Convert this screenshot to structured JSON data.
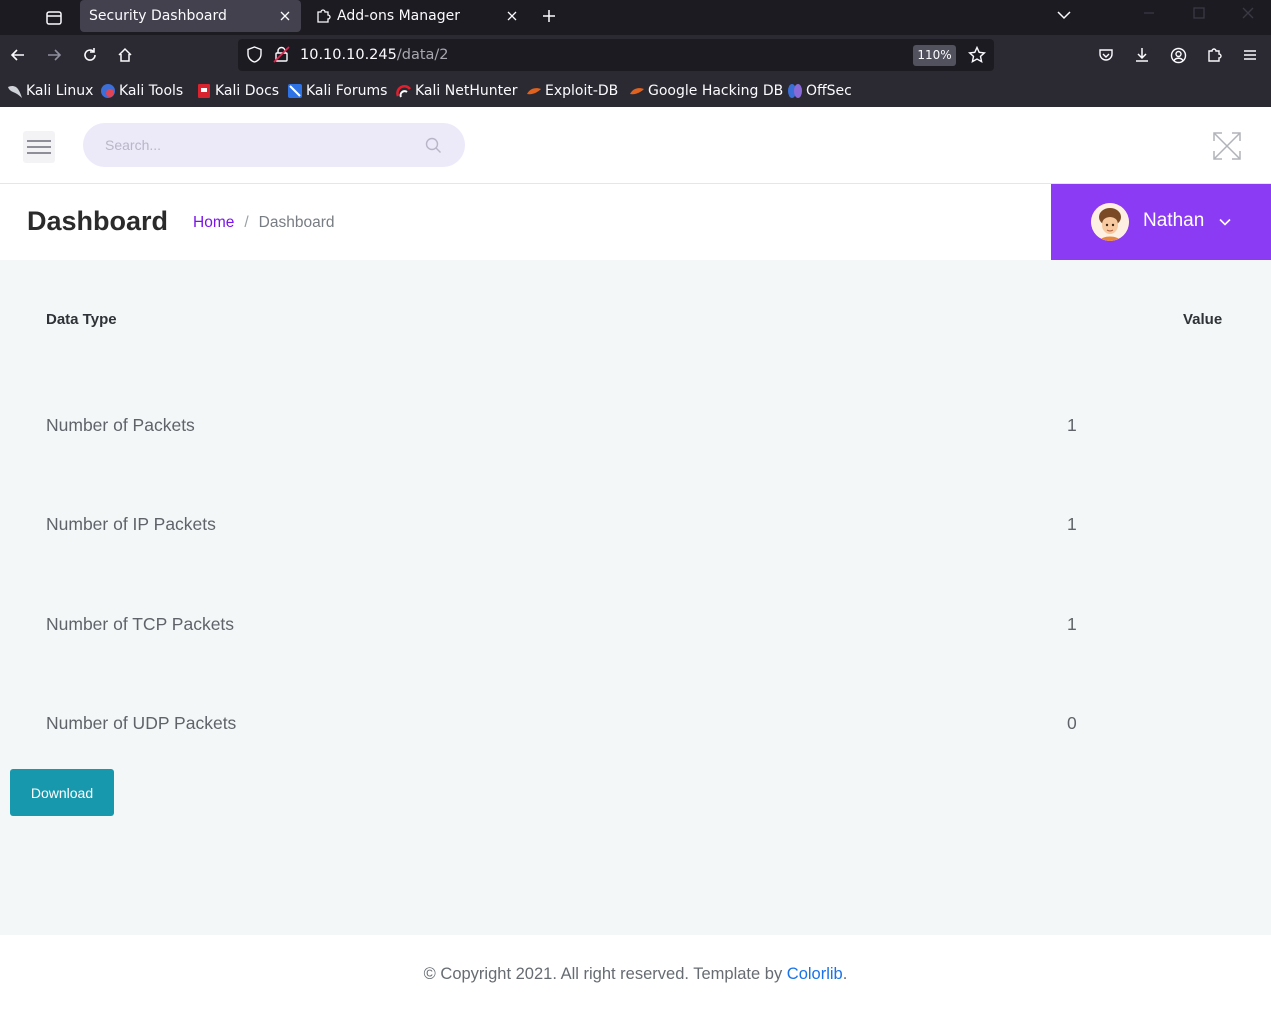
{
  "browser": {
    "tabs": [
      {
        "title": "Security Dashboard",
        "active": true
      },
      {
        "title": "Add-ons Manager",
        "active": false
      }
    ],
    "url_host": "10.10.10.245",
    "url_path": "/data/2",
    "zoom": "110%",
    "bookmarks": [
      {
        "label": "Kali Linux",
        "icon": "kali-dragon-icon"
      },
      {
        "label": "Kali Tools",
        "icon": "kali-tools-icon"
      },
      {
        "label": "Kali Docs",
        "icon": "kali-docs-icon"
      },
      {
        "label": "Kali Forums",
        "icon": "kali-forums-icon"
      },
      {
        "label": "Kali NetHunter",
        "icon": "kali-nethunter-icon"
      },
      {
        "label": "Exploit-DB",
        "icon": "exploit-db-icon"
      },
      {
        "label": "Google Hacking DB",
        "icon": "ghdb-icon"
      },
      {
        "label": "OffSec",
        "icon": "offsec-icon"
      }
    ]
  },
  "header": {
    "search_placeholder": "Search..."
  },
  "breadcrumb": {
    "title": "Dashboard",
    "home": "Home",
    "separator": "/",
    "current": "Dashboard"
  },
  "user": {
    "name": "Nathan"
  },
  "table": {
    "columns": [
      "Data Type",
      "Value"
    ],
    "rows": [
      {
        "label": "Number of Packets",
        "value": "1"
      },
      {
        "label": "Number of IP Packets",
        "value": "1"
      },
      {
        "label": "Number of TCP Packets",
        "value": "1"
      },
      {
        "label": "Number of UDP Packets",
        "value": "0"
      }
    ]
  },
  "actions": {
    "download_label": "Download"
  },
  "footer": {
    "text": "© Copyright 2021. All right reserved. Template by ",
    "link": "Colorlib",
    "suffix": "."
  },
  "colors": {
    "accent": "#8c3bf5",
    "link": "#7c14e8",
    "download_button": "#1798ad"
  }
}
